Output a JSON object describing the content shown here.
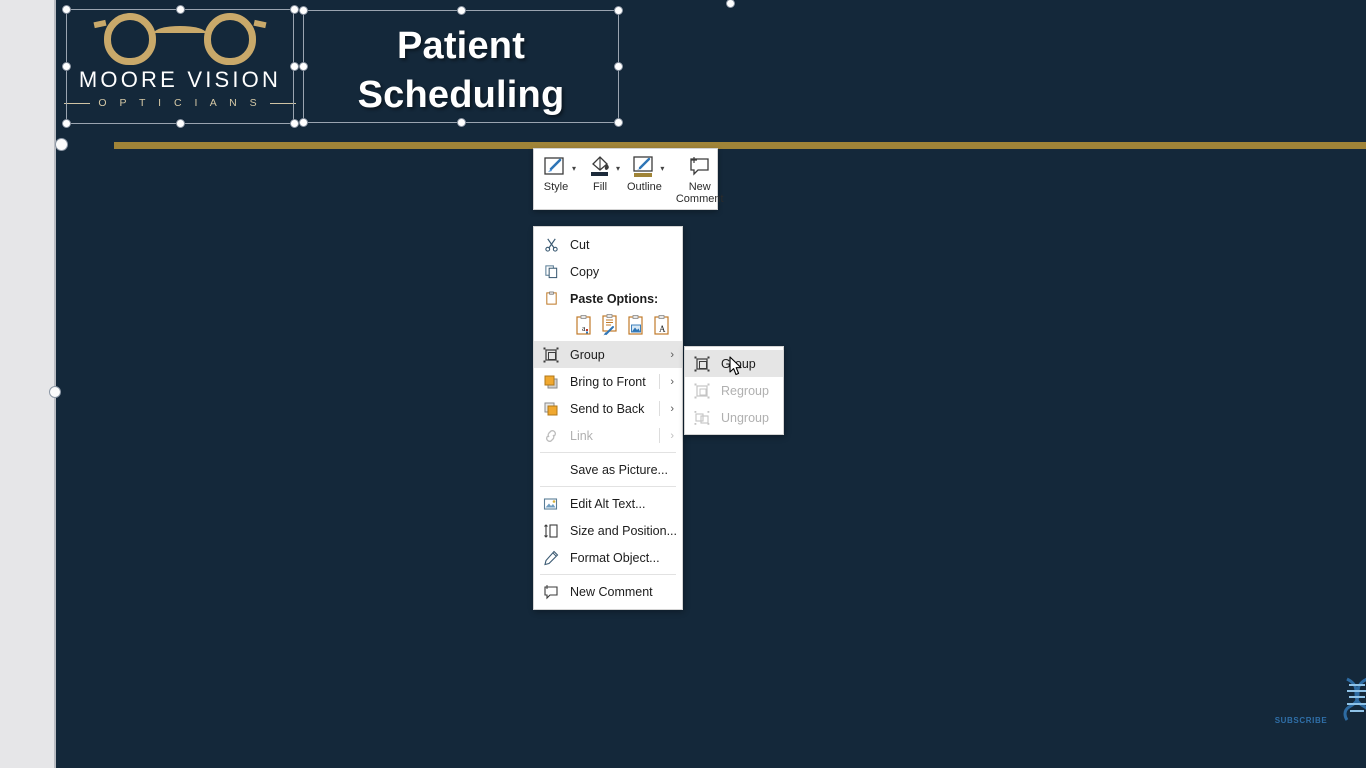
{
  "slide": {
    "background_color": "#14283a",
    "divider_color": "#a08438",
    "logo": {
      "brand_name": "MOORE VISION",
      "brand_sub": "O P T I C I A N S",
      "glasses_color": "#c9a96a",
      "icon": "eyeglasses-icon"
    },
    "title": {
      "text": "Patient\nScheduling",
      "color": "#ffffff"
    }
  },
  "mini_toolbar": {
    "items": [
      {
        "label": "Style",
        "icon": "style-icon",
        "has_dropdown": true
      },
      {
        "label": "Fill",
        "icon": "fill-bucket-icon",
        "has_dropdown": true
      },
      {
        "label": "Outline",
        "icon": "outline-pen-icon",
        "has_dropdown": true
      },
      {
        "label": "New\nComment",
        "icon": "new-comment-icon",
        "has_dropdown": false
      }
    ]
  },
  "context_menu": {
    "items": [
      {
        "label": "Cut",
        "icon": "scissors-icon",
        "type": "item",
        "disabled": false,
        "submenu": false,
        "bold": false
      },
      {
        "label": "Copy",
        "icon": "copy-icon",
        "type": "item",
        "disabled": false,
        "submenu": false,
        "bold": false
      },
      {
        "label": "Paste Options:",
        "icon": "clipboard-icon",
        "type": "item",
        "disabled": false,
        "submenu": false,
        "bold": true
      },
      {
        "type": "paste-options"
      },
      {
        "label": "Group",
        "icon": "group-icon",
        "type": "item",
        "disabled": false,
        "submenu": true,
        "bold": false,
        "highlighted": true
      },
      {
        "label": "Bring to Front",
        "icon": "bring-to-front-icon",
        "type": "item",
        "disabled": false,
        "submenu": true,
        "bold": false
      },
      {
        "label": "Send to Back",
        "icon": "send-to-back-icon",
        "type": "item",
        "disabled": false,
        "submenu": true,
        "bold": false
      },
      {
        "label": "Link",
        "icon": "link-icon",
        "type": "item",
        "disabled": true,
        "submenu": true,
        "bold": false
      },
      {
        "type": "separator"
      },
      {
        "label": "Save as Picture...",
        "icon": "none",
        "type": "item",
        "disabled": false,
        "submenu": false,
        "bold": false
      },
      {
        "type": "separator"
      },
      {
        "label": "Edit Alt Text...",
        "icon": "alt-text-icon",
        "type": "item",
        "disabled": false,
        "submenu": false,
        "bold": false
      },
      {
        "label": "Size and Position...",
        "icon": "size-position-icon",
        "type": "item",
        "disabled": false,
        "submenu": false,
        "bold": false
      },
      {
        "label": "Format Object...",
        "icon": "format-object-icon",
        "type": "item",
        "disabled": false,
        "submenu": false,
        "bold": false
      },
      {
        "type": "separator"
      },
      {
        "label": "New Comment",
        "icon": "new-comment-icon",
        "type": "item",
        "disabled": false,
        "submenu": false,
        "bold": false
      }
    ],
    "paste_options": [
      "use-destination-theme-icon",
      "keep-source-formatting-icon",
      "picture-icon",
      "keep-text-only-icon"
    ]
  },
  "submenu": {
    "items": [
      {
        "label": "Group",
        "icon": "group-icon",
        "disabled": false,
        "highlighted": true
      },
      {
        "label": "Regroup",
        "icon": "regroup-icon",
        "disabled": true,
        "highlighted": false
      },
      {
        "label": "Ungroup",
        "icon": "ungroup-icon",
        "disabled": true,
        "highlighted": false
      }
    ]
  },
  "watermark": {
    "label": "SUBSCRIBE",
    "icon": "dna-helix-icon",
    "color": "#2f6fa8"
  }
}
